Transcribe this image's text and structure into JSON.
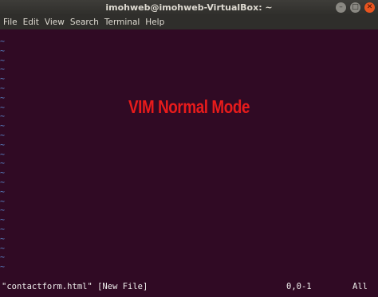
{
  "window": {
    "title": "imohweb@imohweb-VirtualBox: ~",
    "buttons": {
      "minimize": "–",
      "maximize": "□",
      "close": "✕"
    }
  },
  "menubar": {
    "items": [
      "File",
      "Edit",
      "View",
      "Search",
      "Terminal",
      "Help"
    ]
  },
  "editor": {
    "tilde": "~",
    "empty_line_count": 25,
    "overlay_text": "VIM Normal Mode",
    "status": {
      "file_message": "\"contactform.html\" [New File]",
      "cursor_position": "0,0-1",
      "scroll_position": "All"
    }
  },
  "colors": {
    "terminal_background": "#300a24",
    "tilde": "#5c8fd6",
    "overlay_text": "#e81b1b"
  }
}
